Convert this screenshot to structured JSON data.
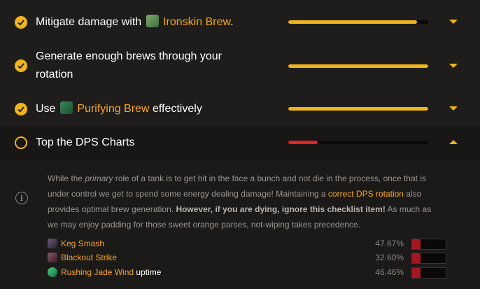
{
  "checklist": [
    {
      "status": "complete",
      "parts": {
        "pre": "Mitigate damage with ",
        "spell": "Ironskin Brew",
        "post": "."
      },
      "progress": 0.92
    },
    {
      "status": "complete",
      "line1": "Generate enough brews through your",
      "line2": "rotation",
      "progress": 1.0
    },
    {
      "status": "complete",
      "parts": {
        "pre": "Use ",
        "spell": "Purifying Brew",
        "post": " effectively"
      },
      "progress": 1.0
    },
    {
      "status": "incomplete",
      "label": "Top the DPS Charts",
      "progress": 0.2,
      "expanded": true
    }
  ],
  "details": {
    "p1_a": "While the ",
    "p1_em": "primary",
    "p1_b": " role of a tank is to get hit in the face a bunch and not die in the process, once that is under control we get to spend some energy dealing damage! Maintaining a ",
    "p1_link": "correct DPS rotation",
    "p1_c": " also provides optimal brew generation. ",
    "p1_bold": "However, if you are dying, ignore this checklist item!",
    "p1_d": " As much as we may enjoy padding for those sweet orange parses, not-wiping takes precedence."
  },
  "abilities": [
    {
      "name": "Keg Smash",
      "suffix": "",
      "pct": "47.67%",
      "value": 0.4767,
      "icon": "keg-smash-icon"
    },
    {
      "name": "Blackout Strike",
      "suffix": "",
      "pct": "32.60%",
      "value": 0.326,
      "icon": "blackout-strike-icon"
    },
    {
      "name": "Rushing Jade Wind",
      "suffix": " uptime",
      "pct": "46.46%",
      "value": 0.4646,
      "icon": "rushing-jade-wind-icon"
    }
  ],
  "colors": {
    "accent": "#f0b41c",
    "link": "#f5a623",
    "fail": "#e02424"
  }
}
